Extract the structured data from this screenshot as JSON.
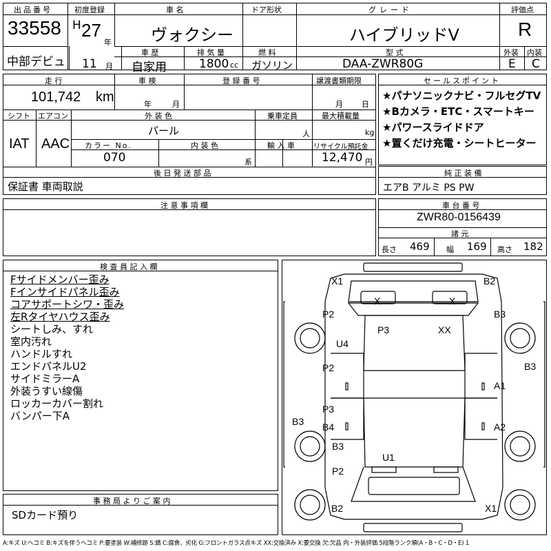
{
  "headers": {
    "lot": "出品番号",
    "first_reg": "初度登録",
    "name": "車 名",
    "door": "ドア形状",
    "grade": "グレード",
    "score": "評価点",
    "year_unit": "年",
    "history": "車 歴",
    "displacement": "排 気 量",
    "fuel": "燃 料",
    "model": "型 式",
    "ext": "外装",
    "int": "内装",
    "month_unit": "月",
    "mileage": "走 行",
    "inspection": "車 検",
    "reg_no": "登 録 番 号",
    "transfer": "譲渡書類期限",
    "sales_points": "セールスポイント",
    "shift": "シフト",
    "ac": "エアコン",
    "ext_color": "外 装 色",
    "capacity": "乗車定員",
    "max_load": "最大積載量",
    "color_no": "カラー No.",
    "int_color": "内 装 色",
    "import": "輸 入 車",
    "recycle": "リサイクル預託金",
    "later_parts": "後 日 発 送 部 品",
    "equipment": "純 正 装 備",
    "notes": "注 意 事 項 欄",
    "chassis": "車 台 番 号",
    "dims": "諸 元",
    "inspector": "検 査 員 記 入 欄",
    "office": "事 務 局 よ り ご 案 内"
  },
  "values": {
    "lot_no": "33558",
    "era": "H",
    "year": "27",
    "month": "11",
    "venue": "中部デビュ",
    "car_name": "ヴォクシー",
    "grade": "ハイブリッドV",
    "score": "R",
    "history": "自家用",
    "cc": "1800",
    "cc_unit": "cc",
    "fuel": "ガソリン",
    "model": "DAA-ZWR80G",
    "ext_score": "E",
    "int_score": "C",
    "mileage": "101,742",
    "km": "km",
    "insp_year": "年",
    "insp_month": "月",
    "transfer_month": "月",
    "transfer_day": "日",
    "shift": "IAT",
    "ac": "AAC",
    "color": "パール",
    "person": "人",
    "kg": "kg",
    "color_no": "070",
    "int_unit": "系",
    "recycle": "12,470",
    "yen": "円",
    "later_parts": "保証書 車両取説",
    "equipment": "エアB アルミ PS PW",
    "chassis_no": "ZWR80-0156439",
    "len_label": "長さ",
    "len": "469",
    "wid_label": "幅",
    "wid": "169",
    "hei_label": "高さ",
    "hei": "182",
    "office_note": "SDカード預り"
  },
  "sales_points": [
    "★パナソニックナビ・フルセグTV",
    "★Bカメラ・ETC・スマートキー",
    "★パワースライドドア",
    "★置くだけ充電・シートヒーター"
  ],
  "inspector_notes": [
    {
      "text": "Fサイドメンバー歪み",
      "ul": true
    },
    {
      "text": "Fインサイドパネル歪み",
      "ul": true
    },
    {
      "text": "コアサポートシワ・歪み",
      "ul": true
    },
    {
      "text": "左Rタイヤハウス歪み",
      "ul": true
    },
    {
      "text": "シートしみ、すれ",
      "ul": false
    },
    {
      "text": "室内汚れ",
      "ul": false
    },
    {
      "text": "ハンドルすれ",
      "ul": false
    },
    {
      "text": "エンドパネルU2",
      "ul": false
    },
    {
      "text": "サイドミラーA",
      "ul": false
    },
    {
      "text": "外装うすい線傷",
      "ul": false
    },
    {
      "text": "ロッカーカバー割れ",
      "ul": false
    },
    {
      "text": "バンパー下A",
      "ul": false
    }
  ],
  "diagram": {
    "x1_top": "X1",
    "b2_top": "B2",
    "x_left": "X",
    "x_right": "X",
    "p2_a": "P2",
    "b3_a": "B3",
    "p3_a": "P3",
    "xx": "XX",
    "u4": "U4",
    "b3_r": "B3",
    "p2_b": "P2",
    "a1": "A1",
    "p3_b": "P3",
    "b3_l": "B3",
    "b4": "B4",
    "a2": "A2",
    "b3_b": "B3",
    "u1": "U1",
    "p2_c": "P2",
    "b2_bot": "B2",
    "x1_bot": "X1"
  },
  "legend": "A:キズ U:ヘコミ B:キズを伴うヘコミ P:要塗装 W:補修跡 S:錆 C:腐食、劣化 G:フロントガラス点キズ XX:交換済み X:要交換 欠:欠品 内・外装評価 5段階ランク順(A・B・C・D・E) 1"
}
